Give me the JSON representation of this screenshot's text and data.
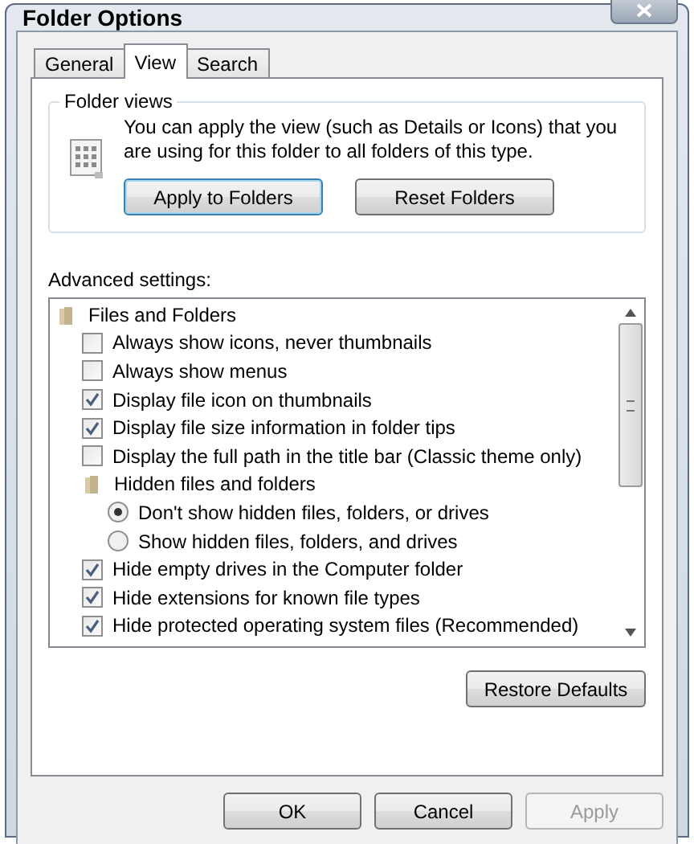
{
  "window": {
    "title": "Folder Options"
  },
  "tabs": [
    {
      "label": "General",
      "selected": false
    },
    {
      "label": "View",
      "selected": true
    },
    {
      "label": "Search",
      "selected": false
    }
  ],
  "folder_views": {
    "title": "Folder views",
    "description": "You can apply the view (such as Details or Icons) that you are using for this folder to all folders of this type.",
    "buttons": [
      {
        "label": "Apply to Folders"
      },
      {
        "label": "Reset Folders"
      }
    ]
  },
  "advanced_settings": {
    "label": "Advanced settings:",
    "items": [
      {
        "kind": "folder",
        "label": "Files and Folders",
        "children": [
          {
            "kind": "checkbox",
            "label": "Always show icons, never thumbnails",
            "checked": false
          },
          {
            "kind": "checkbox",
            "label": "Always show menus",
            "checked": false
          },
          {
            "kind": "checkbox",
            "label": "Display file icon on thumbnails",
            "checked": true
          },
          {
            "kind": "checkbox",
            "label": "Display file size information in folder tips",
            "checked": true
          },
          {
            "kind": "checkbox",
            "label": "Display the full path in the title bar (Classic theme only)",
            "checked": false
          },
          {
            "kind": "folder",
            "label": "Hidden files and folders",
            "children": [
              {
                "kind": "radio",
                "label": "Don't show hidden files, folders, or drives",
                "selected": true
              },
              {
                "kind": "radio",
                "label": "Show hidden files, folders, and drives",
                "selected": false
              }
            ]
          },
          {
            "kind": "checkbox",
            "label": "Hide empty drives in the Computer folder",
            "checked": true
          },
          {
            "kind": "checkbox",
            "label": "Hide extensions for known file types",
            "checked": true
          },
          {
            "kind": "checkbox",
            "label": "Hide protected operating system files (Recommended)",
            "checked": true
          }
        ]
      }
    ]
  },
  "restore_button": {
    "label": "Restore Defaults"
  },
  "dialog_buttons": [
    {
      "label": "OK",
      "disabled": false
    },
    {
      "label": "Cancel",
      "disabled": false
    },
    {
      "label": "Apply",
      "disabled": true
    }
  ]
}
